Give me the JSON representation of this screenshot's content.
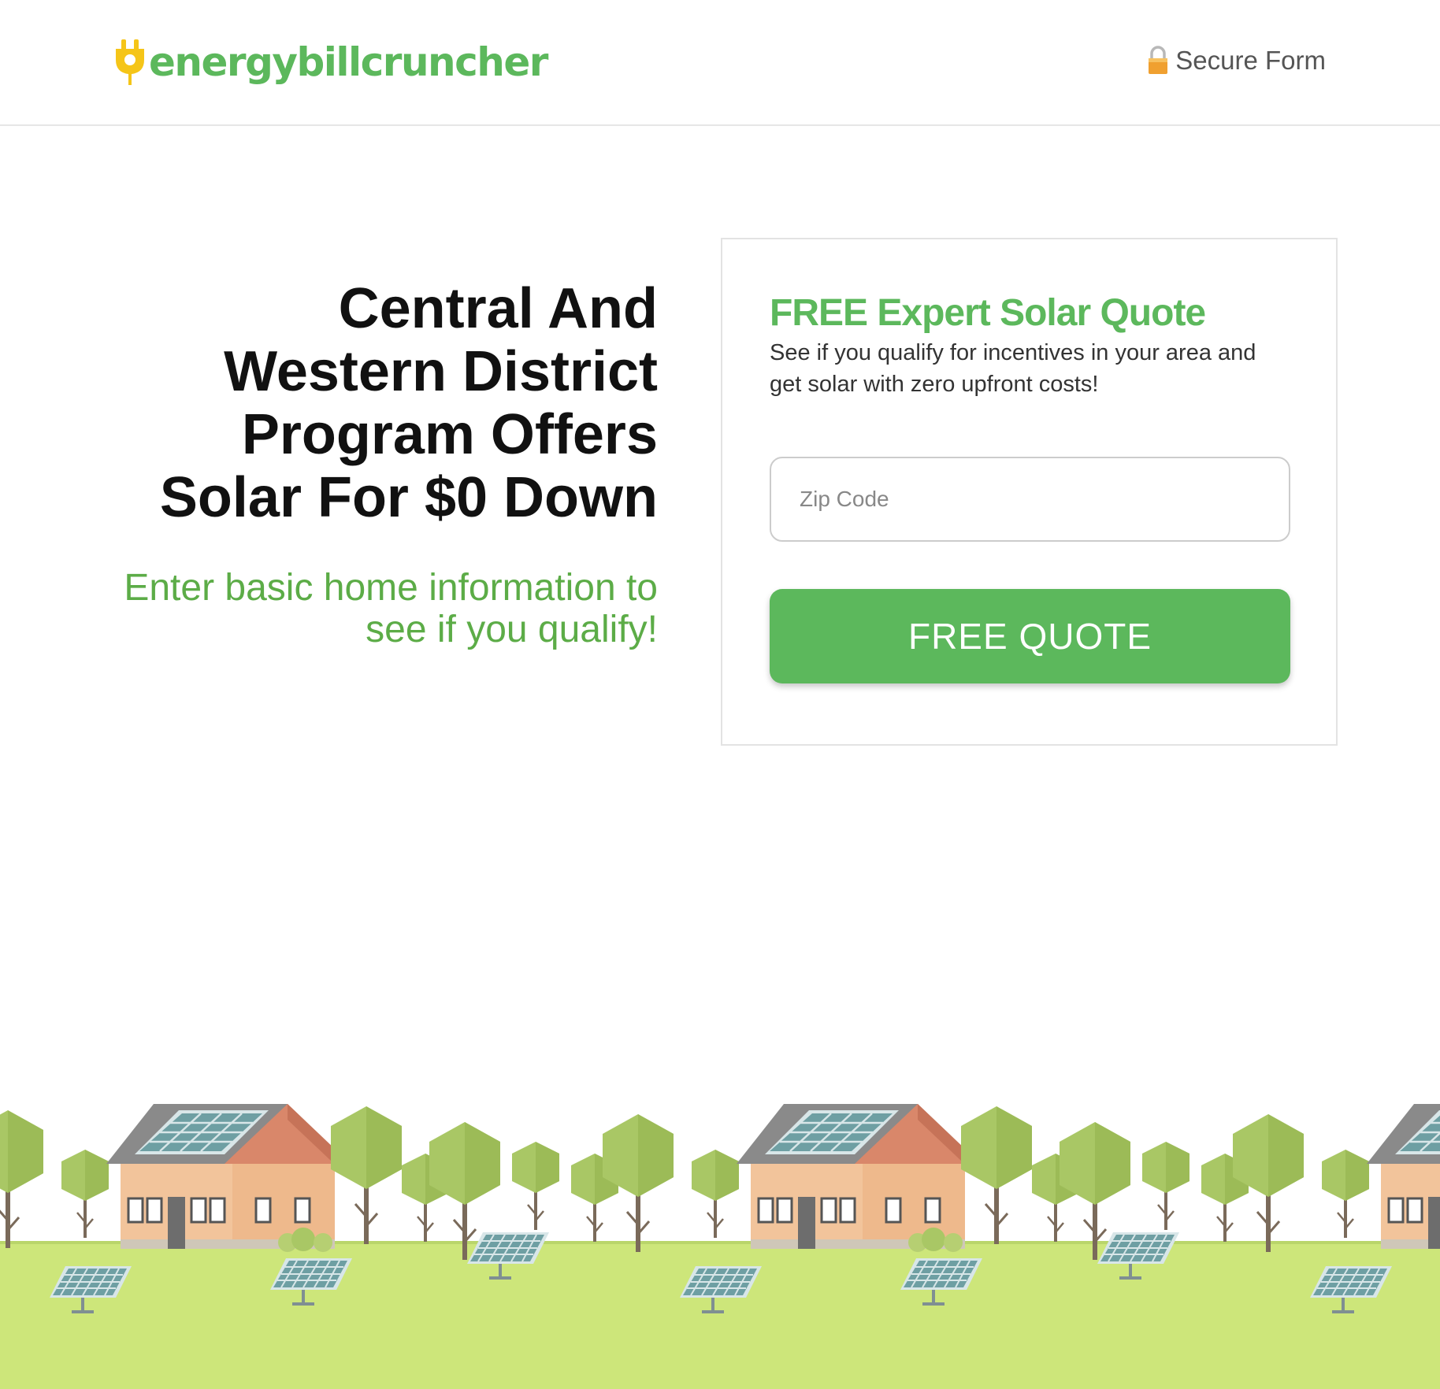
{
  "header": {
    "logo_text": "energybillcruncher",
    "logo_icon": "plug-icon",
    "secure_label": "Secure Form",
    "secure_icon": "lock-icon"
  },
  "hero": {
    "headline": "Central And Western District Program Offers Solar For $0 Down",
    "subheadline": "Enter basic home information to see if you qualify!"
  },
  "form": {
    "title": "FREE Expert Solar Quote",
    "description": "See if you qualify for incentives in your area and get solar with zero upfront costs!",
    "zip_placeholder": "Zip Code",
    "zip_value": "",
    "submit_label": "FREE QUOTE"
  },
  "scenery": {
    "description_icon": "solar-neighborhood-illustration"
  },
  "colors": {
    "brand_green": "#5cb85c",
    "subhead_green": "#5cac47",
    "plug_yellow": "#f5c518",
    "grass": "#cde67a",
    "tree": "#a9c765",
    "house_wall": "#f2c49b",
    "roof_side": "#d9876a",
    "panel": "#6e9fa3"
  }
}
